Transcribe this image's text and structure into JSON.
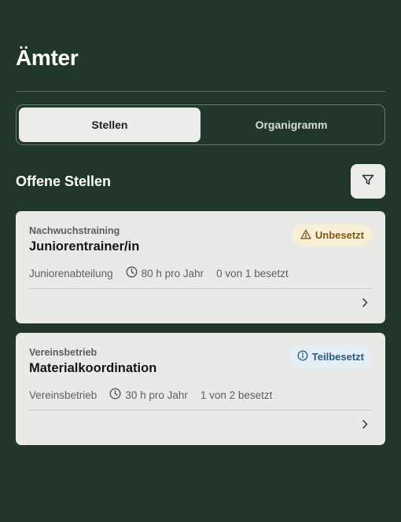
{
  "header": {
    "title": "Ämter"
  },
  "tabs": [
    {
      "label": "Stellen",
      "active": true
    },
    {
      "label": "Organigramm",
      "active": false
    }
  ],
  "section": {
    "title": "Offene Stellen",
    "filter_icon": "filter-icon"
  },
  "positions": [
    {
      "category": "Nachwuchstraining",
      "title": "Juniorentrainer/in",
      "department": "Juniorenabteilung",
      "hours": "80 h pro Jahr",
      "occupancy": "0 von 1 besetzt",
      "status": "Unbesetzt",
      "status_icon": "warning-icon",
      "status_color": "#7a5a16"
    },
    {
      "category": "Vereinsbetrieb",
      "title": "Materialkoordination",
      "department": "Vereinsbetrieb",
      "hours": "30 h pro Jahr",
      "occupancy": "1 von 2 besetzt",
      "status": "Teilbesetzt",
      "status_icon": "info-icon",
      "status_color": "#2c5a7a"
    }
  ],
  "colors": {
    "background": "#21372b",
    "card": "#e9eae8",
    "warn_badge": "#f8efd4",
    "info_badge": "#e5eef4"
  }
}
